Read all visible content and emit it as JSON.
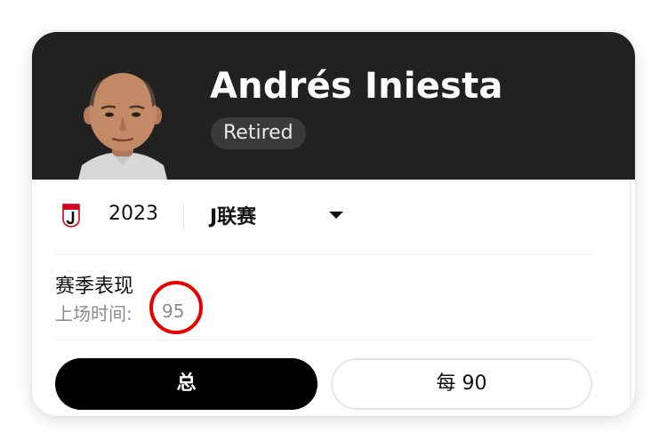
{
  "player": {
    "name": "Andrés Iniesta",
    "status": "Retired"
  },
  "selectors": {
    "season": "2023",
    "league": "J联赛"
  },
  "stats": {
    "section_title": "赛季表现",
    "minutes_label": "上场时间:",
    "minutes_value": "95"
  },
  "toggle": {
    "total_label": "总",
    "per90_label": "每 90"
  },
  "icons": {
    "league_logo": "j-league-logo-icon",
    "dropdown": "caret-down-icon"
  },
  "colors": {
    "header_bg": "#212121",
    "accent_circle": "#e80000",
    "active_toggle": "#000000"
  }
}
